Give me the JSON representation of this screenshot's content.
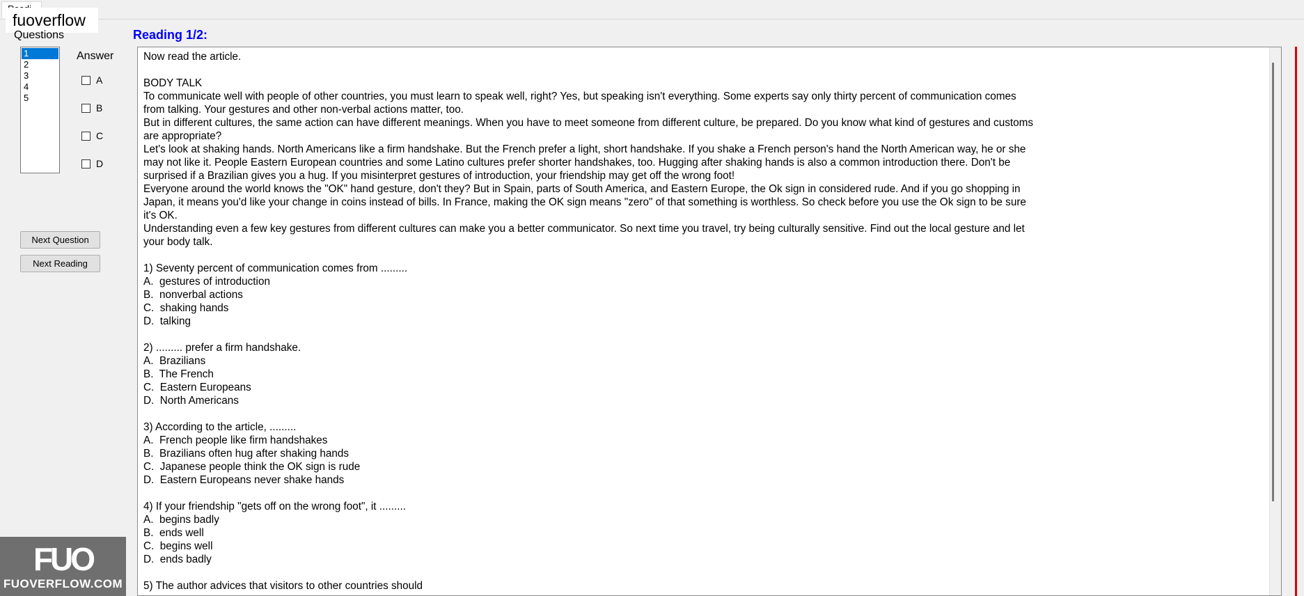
{
  "window": {
    "tab_label": "Readi...",
    "watermark_text": "fuoverflow"
  },
  "sidebar": {
    "questions_label": "Questions",
    "questions": [
      "1",
      "2",
      "3",
      "4",
      "5"
    ],
    "selected_question": "1",
    "answer_label": "Answer",
    "options": [
      "A",
      "B",
      "C",
      "D"
    ],
    "buttons": {
      "next_question": "Next Question",
      "next_reading": "Next Reading"
    }
  },
  "reading": {
    "title": "Reading 1/2:",
    "body": "Now read the article.\n\nBODY TALK\nTo communicate well with people of other countries, you must learn to speak well, right? Yes, but speaking isn't everything. Some experts say only thirty percent of communication comes\nfrom talking. Your gestures and other non-verbal actions matter, too.\nBut in different cultures, the same action can have different meanings. When you have to meet someone from different culture, be prepared. Do you know what kind of gestures and customs\nare appropriate?\nLet's look at shaking hands. North Americans like a firm handshake. But the French prefer a light, short handshake. If you shake a French person's hand the North American way, he or she\nmay not like it. People Eastern European countries and some Latino cultures prefer shorter handshakes, too. Hugging after shaking hands is also a common introduction there. Don't be\nsurprised if a Brazilian gives you a hug. If you misinterpret gestures of introduction, your friendship may get off the wrong foot!\nEveryone around the world knows the \"OK\" hand gesture, don't they? But in Spain, parts of South America, and Eastern Europe, the Ok sign in considered rude. And if you go shopping in\nJapan, it means you'd like your change in coins instead of bills. In France, making the OK sign means \"zero\" of that something is worthless. So check before you use the Ok sign to be sure\nit's OK.\nUnderstanding even a few key gestures from different cultures can make you a better communicator. So next time you travel, try being culturally sensitive. Find out the local gesture and let\nyour body talk.\n\n1) Seventy percent of communication comes from .........\nA.  gestures of introduction\nB.  nonverbal actions\nC.  shaking hands\nD.  talking\n\n2) ......... prefer a firm handshake.\nA.  Brazilians\nB.  The French\nC.  Eastern Europeans\nD.  North Americans\n\n3) According to the article, .........\nA.  French people like firm handshakes\nB.  Brazilians often hug after shaking hands\nC.  Japanese people think the OK sign is rude\nD.  Eastern Europeans never shake hands\n\n4) If your friendship \"gets off on the wrong foot\", it .........\nA.  begins badly\nB.  ends well\nC.  begins well\nD.  ends badly\n\n5) The author advices that visitors to other countries should"
  },
  "logo": {
    "mark": "FUO",
    "text": "FUOVERFLOW.COM"
  }
}
